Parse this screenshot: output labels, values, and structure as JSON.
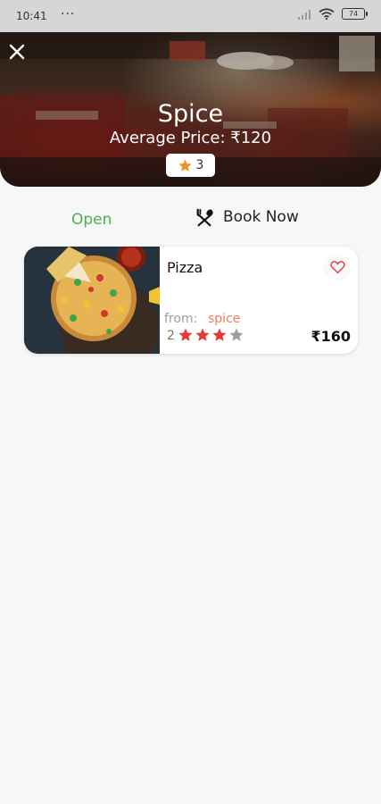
{
  "status_bar": {
    "time": "10:41",
    "dots": "···",
    "battery": "74"
  },
  "hero": {
    "title": "Spice",
    "average_price": "Average Price: ₹120",
    "rating": "3",
    "close_icon": "close-icon",
    "star_color": "#f0901e"
  },
  "actions": {
    "status": "Open",
    "status_color": "#4caf50",
    "book_label": "Book Now",
    "book_icon": "fork-spoon-icon"
  },
  "menu_items": [
    {
      "name": "Pizza",
      "from_label": "from:",
      "from_source": "spice",
      "rating_count": "2",
      "stars_filled": 3,
      "stars_total": 4,
      "price": "₹160",
      "favorite_icon": "heart-outline-icon",
      "star_color": "#e53935",
      "star_empty_color": "#9e9e9e"
    }
  ]
}
